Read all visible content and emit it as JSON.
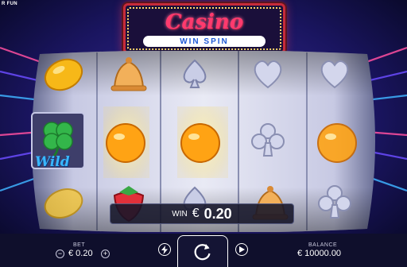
{
  "header": {
    "brand_label": "R FUN"
  },
  "logo": {
    "title": "Casino",
    "subtitle": "WIN SPIN"
  },
  "reels": [
    {
      "symbols": [
        "lemon",
        "clover-wild",
        "lemon"
      ]
    },
    {
      "symbols": [
        "bell",
        "orange",
        "strawberry"
      ]
    },
    {
      "symbols": [
        "spade",
        "orange",
        "spade"
      ]
    },
    {
      "symbols": [
        "heart",
        "club",
        "bell"
      ]
    },
    {
      "symbols": [
        "heart",
        "orange",
        "club"
      ]
    }
  ],
  "wild_label": "Wild",
  "win": {
    "label": "WIN",
    "currency": "€",
    "value": "0.20"
  },
  "bet": {
    "label": "BET",
    "value": "€ 0.20",
    "minus": "−",
    "plus": "+"
  },
  "balance": {
    "label": "BALANCE",
    "value": "€ 10000.00"
  },
  "colors": {
    "accent_red": "#c72b3a",
    "logo_blue": "#1f5ad6",
    "highlight": "#fff3a0"
  },
  "icons": {
    "turbo": "lightning-icon",
    "spin": "spin-arrow-icon",
    "autoplay": "play-icon"
  }
}
